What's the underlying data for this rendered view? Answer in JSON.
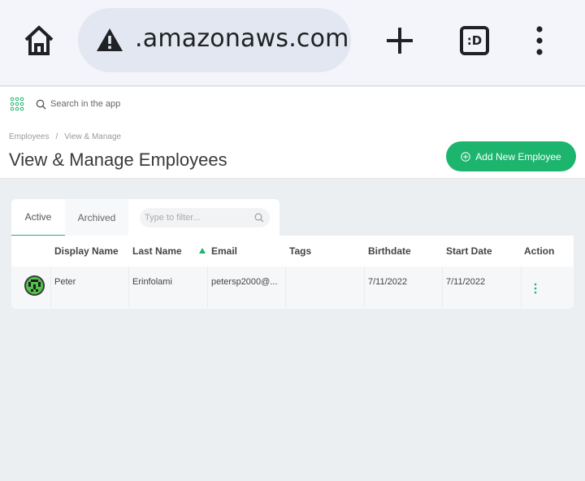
{
  "browser": {
    "url": ".amazonaws.com",
    "tab_count_label": ":D",
    "icons": [
      "home-icon",
      "warning-icon",
      "plus-icon",
      "tabs-icon",
      "more-icon"
    ]
  },
  "appbar": {
    "search_placeholder": "Search in the app",
    "icons": [
      "apps-grid-icon",
      "search-icon"
    ]
  },
  "header": {
    "breadcrumb": [
      "Employees",
      "/",
      "View & Manage"
    ],
    "title": "View & Manage Employees",
    "add_button_label": "Add New Employee"
  },
  "tabs": [
    {
      "label": "Active",
      "selected": true
    },
    {
      "label": "Archived",
      "selected": false
    }
  ],
  "filter": {
    "placeholder": "Type to filter..."
  },
  "table": {
    "columns": [
      "Display Name",
      "Last Name",
      "Email",
      "Tags",
      "Birthdate",
      "Start Date",
      "Action"
    ],
    "sorted_column": "Email",
    "rows": [
      {
        "display_name": "Peter",
        "last_name": "Erinfolami",
        "email": "petersp2000@...",
        "tags": "",
        "birthdate": "7/11/2022",
        "start_date": "7/11/2022"
      }
    ]
  },
  "colors": {
    "accent": "#1db56e",
    "background": "#eceff1",
    "chrome": "#f4f5fb"
  }
}
